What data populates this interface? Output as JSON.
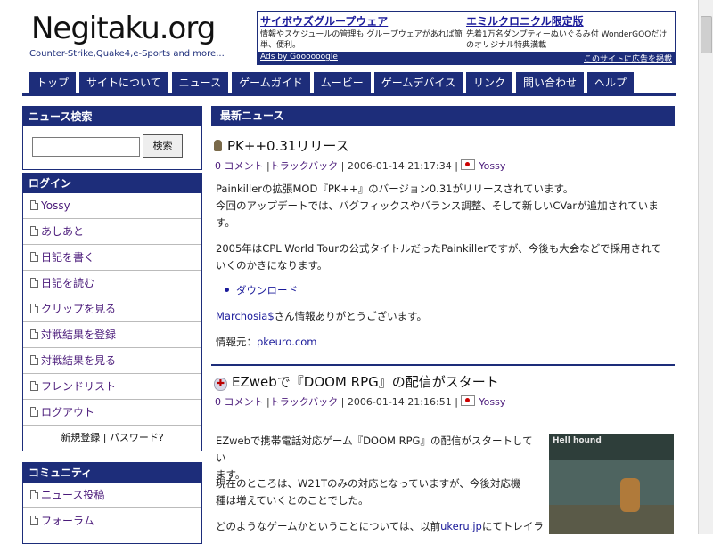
{
  "header": {
    "logo": "Negitaku.org",
    "tagline": "Counter-Strike,Quake4,e-Sports and more..."
  },
  "ad": {
    "left": {
      "title": "サイボウズグループウェア",
      "desc": "情報やスケジュールの管理も グループウェアがあれば簡単、便利。"
    },
    "right": {
      "title": "エミルクロニクル限定版",
      "desc": "先着1万名ダンプティーぬいぐるみ付 WonderGOOだけのオリジナル特典満載"
    },
    "by": "Ads by Goooooogle",
    "cta": "このサイトに広告を掲載"
  },
  "nav": [
    "トップ",
    "サイトについて",
    "ニュース",
    "ゲームガイド",
    "ムービー",
    "ゲームデバイス",
    "リンク",
    "問い合わせ",
    "ヘルプ"
  ],
  "sidebar": {
    "search": {
      "title": "ニュース検索",
      "button": "検索"
    },
    "login": {
      "title": "ログイン",
      "items": [
        "Yossy",
        "あしあと",
        "日記を書く",
        "日記を読む",
        "クリップを見る",
        "対戦結果を登録",
        "対戦結果を見る",
        "フレンドリスト",
        "ログアウト"
      ],
      "register": "新規登録",
      "divider": "|",
      "password": "パスワード?"
    },
    "community": {
      "title": "コミュニティ",
      "items": [
        "ニュース投稿",
        "フォーラム"
      ]
    }
  },
  "main": {
    "heading": "最新ニュース",
    "posts": [
      {
        "title": "PK++0.31リリース",
        "comments": "0 コメント",
        "trackback": "トラックバック",
        "date": "2006-01-14 21:17:34",
        "author": "Yossy",
        "p1a": "Painkillerの拡張MOD『PK++』のバージョン0.31がリリースされています。",
        "p1b": "今回のアップデートでは、バグフィックスやバランス調整、そして新しいCVarが追加されていま",
        "p1c": "す。",
        "p2a": "2005年はCPL World Tourの公式タイトルだったPainkillerですが、今後も大会などで採用されて",
        "p2b": "いくのかきになります。",
        "download": "ダウンロード",
        "thanks_name": "Marchosia$",
        "thanks_rest": "さん情報ありがとうございます。",
        "source_label": "情報元：",
        "source_link": "pkeuro.com"
      },
      {
        "title": "EZwebで『DOOM RPG』の配信がスタート",
        "comments": "0 コメント",
        "trackback": "トラックバック",
        "date": "2006-01-14 21:16:51",
        "author": "Yossy",
        "p1a": "EZwebで携帯電話対応ゲーム『DOOM RPG』の配信がスタートしてい",
        "p1b": "ます。",
        "p2a": "現在のところは、W21Tのみの対応となっていますが、今後対応機",
        "p2b": "種は増えていくとのことでした。",
        "p3a": "どのようなゲームかということについては、以前",
        "p3link": "ukeru.jp",
        "p3b": "にてトレイラ",
        "image_caption": "Hell hound"
      }
    ]
  }
}
